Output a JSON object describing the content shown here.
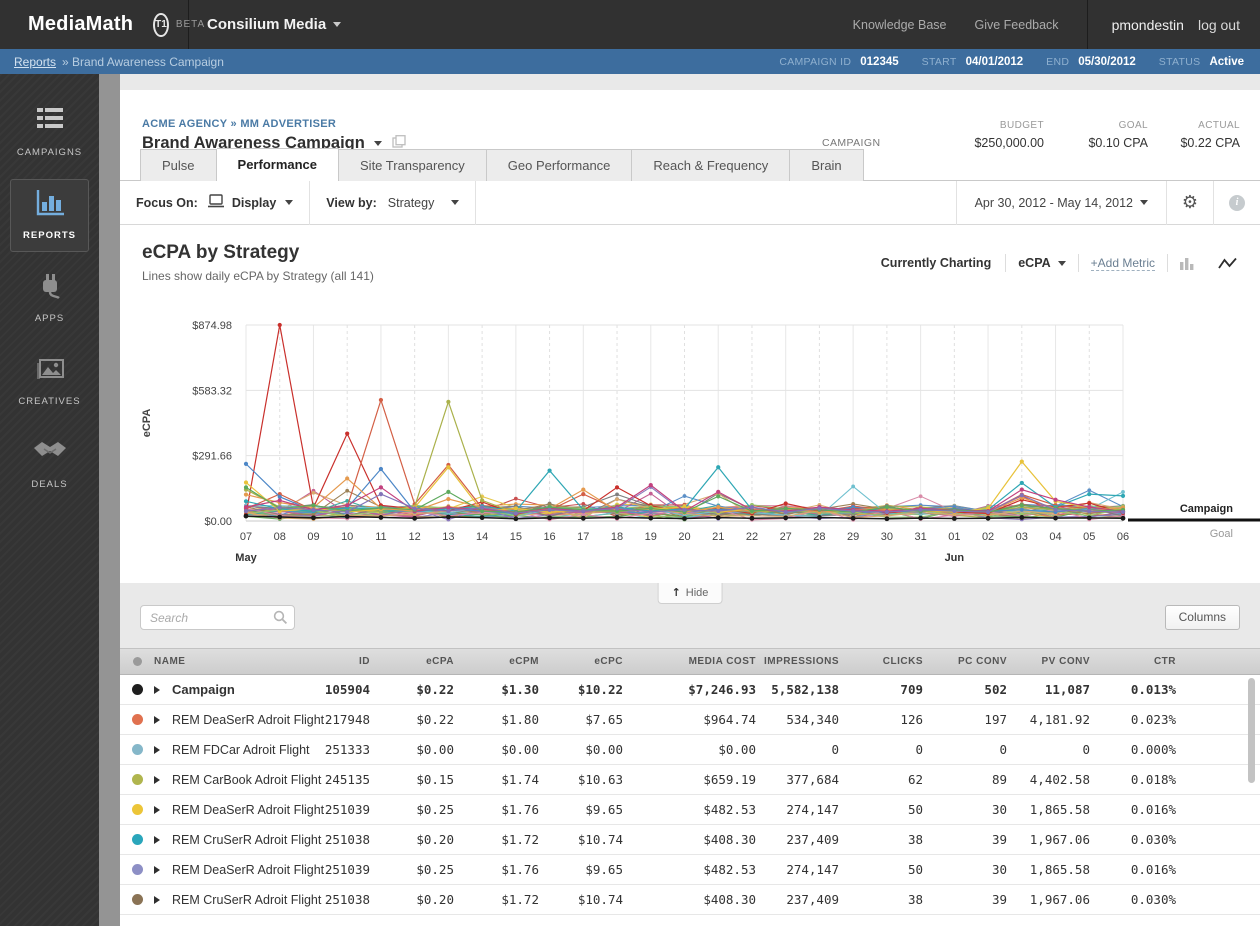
{
  "topbar": {
    "brand": "MediaMath",
    "logo_badge": "T1",
    "beta": "BETA",
    "account": "Consilium Media",
    "links": [
      "Knowledge Base",
      "Give Feedback"
    ],
    "user": "pmondestin",
    "logout": "log out"
  },
  "breadcrumb_bar": {
    "link": "Reports",
    "rest": "» Brand Awareness Campaign",
    "campaign_id_label": "CAMPAIGN ID",
    "campaign_id": "012345",
    "start_label": "START",
    "start": "04/01/2012",
    "end_label": "END",
    "end": "05/30/2012",
    "status_label": "STATUS",
    "status": "Active"
  },
  "sidebar": {
    "items": [
      {
        "label": "CAMPAIGNS",
        "icon": "list-icon",
        "active": false
      },
      {
        "label": "REPORTS",
        "icon": "bar-chart-icon",
        "active": true
      },
      {
        "label": "APPS",
        "icon": "plug-icon",
        "active": false
      },
      {
        "label": "CREATIVES",
        "icon": "image-icon",
        "active": false
      },
      {
        "label": "DEALS",
        "icon": "handshake-icon",
        "active": false
      }
    ]
  },
  "campaign_header": {
    "agency_breadcrumb": "ACME AGENCY » MM ADVERTISER",
    "title": "Brand Awareness Campaign",
    "row_label": "CAMPAIGN",
    "budget_label": "BUDGET",
    "budget": "$250,000.00",
    "goal_label": "GOAL",
    "goal": "$0.10 CPA",
    "actual_label": "ACTUAL",
    "actual": "$0.22 CPA"
  },
  "tabs": [
    {
      "label": "Pulse",
      "active": false
    },
    {
      "label": "Performance",
      "active": true
    },
    {
      "label": "Site Transparency",
      "active": false
    },
    {
      "label": "Geo Performance",
      "active": false
    },
    {
      "label": "Reach & Frequency",
      "active": false
    },
    {
      "label": "Brain",
      "active": false
    }
  ],
  "toolbar": {
    "focus_label": "Focus On:",
    "focus_value": "Display",
    "viewby_label": "View by:",
    "viewby_value": "Strategy",
    "date_range": "Apr 30, 2012 - May 14, 2012"
  },
  "chart": {
    "title": "eCPA by Strategy",
    "subtitle": "Lines show daily eCPA by Strategy (all 141)",
    "charting_label": "Currently Charting",
    "metric": "eCPA",
    "add_metric": "+Add Metric",
    "campaign_line_label": "Campaign",
    "goal_line_label": "Goal"
  },
  "chart_data": {
    "type": "line",
    "ylabel": "eCPA",
    "ylim": [
      0,
      874.98
    ],
    "grid": true,
    "x_labels": [
      "07",
      "08",
      "09",
      "10",
      "11",
      "12",
      "13",
      "14",
      "15",
      "16",
      "17",
      "18",
      "19",
      "20",
      "21",
      "22",
      "27",
      "28",
      "29",
      "30",
      "31",
      "01",
      "02",
      "03",
      "04",
      "05",
      "06"
    ],
    "month_labels": [
      {
        "label": "May",
        "index": 0
      },
      {
        "label": "Jun",
        "index": 21
      }
    ],
    "y_ticks": [
      {
        "label": "$874.98",
        "value": 874.98
      },
      {
        "label": "$583.32",
        "value": 583.32
      },
      {
        "label": "$291.66",
        "value": 291.66
      },
      {
        "label": "$0.00",
        "value": 0
      }
    ],
    "series": [
      {
        "name": "strategy-red",
        "color": "#c9302c",
        "values": [
          28,
          874.98,
          60,
          390,
          70,
          55,
          45,
          85,
          30,
          58,
          46,
          150,
          68,
          40,
          55,
          34,
          78,
          46,
          60,
          36,
          50,
          40,
          34,
          95,
          60,
          80,
          36
        ]
      },
      {
        "name": "strategy-vermilion",
        "color": "#d35f45",
        "values": [
          55,
          120,
          48,
          62,
          540,
          75,
          250,
          58,
          36,
          48,
          120,
          52,
          44,
          58,
          40,
          48,
          56,
          42,
          66,
          50,
          44,
          52,
          40,
          118,
          70,
          55,
          44
        ]
      },
      {
        "name": "strategy-olive",
        "color": "#aab14b",
        "values": [
          140,
          62,
          46,
          55,
          42,
          64,
          532,
          92,
          36,
          54,
          46,
          40,
          62,
          44,
          52,
          40,
          48,
          60,
          46,
          40,
          52,
          44,
          40,
          62,
          50,
          56,
          40
        ]
      },
      {
        "name": "strategy-blue",
        "color": "#4d87c7",
        "values": [
          255,
          108,
          46,
          58,
          232,
          42,
          56,
          44,
          34,
          60,
          50,
          44,
          56,
          40,
          52,
          44,
          56,
          40,
          62,
          44,
          40,
          56,
          44,
          50,
          40,
          56,
          44
        ]
      },
      {
        "name": "strategy-teal",
        "color": "#2fa7b4",
        "values": [
          88,
          54,
          44,
          60,
          50,
          44,
          54,
          66,
          44,
          225,
          50,
          62,
          44,
          54,
          240,
          50,
          44,
          60,
          52,
          44,
          54,
          44,
          50,
          170,
          62,
          120,
          112
        ]
      },
      {
        "name": "strategy-yellow",
        "color": "#e8c23a",
        "values": [
          172,
          44,
          56,
          40,
          52,
          60,
          240,
          44,
          56,
          40,
          50,
          44,
          54,
          62,
          40,
          52,
          44,
          56,
          40,
          50,
          44,
          40,
          56,
          265,
          88,
          60,
          50
        ]
      },
      {
        "name": "strategy-orange",
        "color": "#e59a4e",
        "values": [
          118,
          82,
          60,
          190,
          56,
          44,
          98,
          60,
          40,
          54,
          140,
          44,
          54,
          40,
          62,
          44,
          56,
          40,
          50,
          60,
          44,
          50,
          40,
          104,
          56,
          44,
          60
        ]
      },
      {
        "name": "strategy-magenta",
        "color": "#c2417e",
        "values": [
          62,
          92,
          50,
          70,
          150,
          44,
          60,
          52,
          40,
          56,
          44,
          62,
          160,
          44,
          130,
          50,
          44,
          62,
          50,
          44,
          56,
          50,
          44,
          140,
          95,
          62,
          44
        ]
      },
      {
        "name": "strategy-green",
        "color": "#5da95c",
        "values": [
          150,
          56,
          70,
          44,
          60,
          50,
          130,
          44,
          40,
          62,
          50,
          44,
          56,
          40,
          110,
          44,
          56,
          50,
          40,
          62,
          44,
          50,
          40,
          70,
          56,
          44,
          50
        ]
      },
      {
        "name": "strategy-purple",
        "color": "#8273b8",
        "values": [
          44,
          60,
          50,
          40,
          120,
          56,
          44,
          60,
          34,
          50,
          44,
          56,
          40,
          50,
          44,
          62,
          40,
          56,
          44,
          40,
          50,
          44,
          40,
          115,
          50,
          44,
          40
        ]
      },
      {
        "name": "campaign",
        "color": "#1a1a1a",
        "values": [
          22,
          18,
          14,
          20,
          16,
          12,
          18,
          15,
          10,
          14,
          12,
          16,
          13,
          11,
          15,
          12,
          14,
          16,
          12,
          10,
          13,
          11,
          12,
          16,
          13,
          14,
          12
        ]
      }
    ],
    "background_series": {
      "count": 30,
      "seed": 42,
      "min": 3,
      "max": 55,
      "spike_chance": 0.05,
      "spike_max": 110,
      "palette": [
        "#c94f4f",
        "#e59a4e",
        "#e6c84e",
        "#a9b34f",
        "#69a85e",
        "#3fa9a0",
        "#5b8fc7",
        "#8b79bd",
        "#c45f93",
        "#9c8257",
        "#7f7f7f",
        "#d98ba8",
        "#6fc0cf",
        "#97c46e",
        "#d9a96f"
      ]
    }
  },
  "table_controls": {
    "search_placeholder": "Search",
    "columns_button": "Columns",
    "hide_button": "Hide"
  },
  "table": {
    "columns": [
      "NAME",
      "ID",
      "eCPA",
      "eCPM",
      "eCPC",
      "MEDIA COST",
      "IMPRESSIONS",
      "CLICKS",
      "PC CONV",
      "PV CONV",
      "CTR"
    ],
    "rows": [
      {
        "dot": "#1e1e1e",
        "bold": true,
        "name": "Campaign",
        "values": [
          "105904",
          "$0.22",
          "$1.30",
          "$10.22",
          "$7,246.93",
          "5,582,138",
          "709",
          "502",
          "11,087",
          "0.013%"
        ]
      },
      {
        "dot": "#e0714f",
        "bold": false,
        "name": "REM DeaSerR Adroit Flight",
        "values": [
          "217948",
          "$0.22",
          "$1.80",
          "$7.65",
          "$964.74",
          "534,340",
          "126",
          "197",
          "4,181.92",
          "0.023%"
        ]
      },
      {
        "dot": "#85b7c9",
        "bold": false,
        "name": "REM FDCar Adroit Flight",
        "values": [
          "251333",
          "$0.00",
          "$0.00",
          "$0.00",
          "$0.00",
          "0",
          "0",
          "0",
          "0",
          "0.000%"
        ]
      },
      {
        "dot": "#b0b54e",
        "bold": false,
        "name": "REM CarBook Adroit Flight",
        "values": [
          "245135",
          "$0.15",
          "$1.74",
          "$10.63",
          "$659.19",
          "377,684",
          "62",
          "89",
          "4,402.58",
          "0.018%"
        ]
      },
      {
        "dot": "#ecc538",
        "bold": false,
        "name": "REM DeaSerR Adroit Flight",
        "values": [
          "251039",
          "$0.25",
          "$1.76",
          "$9.65",
          "$482.53",
          "274,147",
          "50",
          "30",
          "1,865.58",
          "0.016%"
        ]
      },
      {
        "dot": "#2aa6bb",
        "bold": false,
        "name": "REM CruSerR Adroit Flight",
        "values": [
          "251038",
          "$0.20",
          "$1.72",
          "$10.74",
          "$408.30",
          "237,409",
          "38",
          "39",
          "1,967.06",
          "0.030%"
        ]
      },
      {
        "dot": "#8d8fc5",
        "bold": false,
        "name": "REM DeaSerR Adroit Flight",
        "values": [
          "251039",
          "$0.25",
          "$1.76",
          "$9.65",
          "$482.53",
          "274,147",
          "50",
          "30",
          "1,865.58",
          "0.016%"
        ]
      },
      {
        "dot": "#8a7355",
        "bold": false,
        "name": "REM CruSerR Adroit Flight",
        "values": [
          "251038",
          "$0.20",
          "$1.72",
          "$10.74",
          "$408.30",
          "237,409",
          "38",
          "39",
          "1,967.06",
          "0.030%"
        ]
      }
    ]
  }
}
